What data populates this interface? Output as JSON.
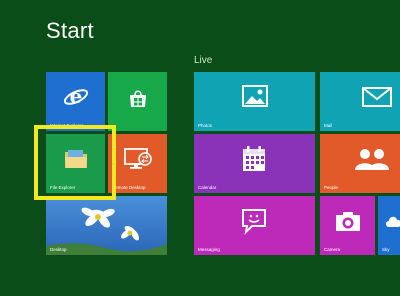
{
  "screen": {
    "title": "Start",
    "group_label": "Live"
  },
  "tiles": {
    "internet_explorer": {
      "label": "Internet Explorer",
      "icon": "internet-explorer-icon"
    },
    "store": {
      "label": "",
      "icon": "store-icon"
    },
    "file_explorer": {
      "label": "File Explorer",
      "icon": "folder-icon"
    },
    "remote_desktop": {
      "label": "Remote Desktop",
      "icon": "remote-desktop-icon"
    },
    "desktop": {
      "label": "Desktop",
      "icon": "desktop-wallpaper-image"
    },
    "photos": {
      "label": "Photos",
      "icon": "photo-icon"
    },
    "mail": {
      "label": "Mail",
      "icon": "envelope-icon"
    },
    "calendar": {
      "label": "Calendar",
      "icon": "calendar-icon"
    },
    "people": {
      "label": "People",
      "icon": "people-icon"
    },
    "messaging": {
      "label": "Messaging",
      "icon": "chat-bubble-icon"
    },
    "camera": {
      "label": "Camera",
      "icon": "camera-icon"
    },
    "skydrive": {
      "label": "Sky",
      "icon": "cloud-icon"
    }
  },
  "colors": {
    "background": "#0b4d18",
    "highlight": "#f2ea1f",
    "ie_blue": "#1e6fd0",
    "store_green": "#17a84a",
    "orange": "#e25a2a",
    "teal": "#0fa3b4",
    "purple": "#8a33b8",
    "magenta": "#bd2ab9"
  }
}
